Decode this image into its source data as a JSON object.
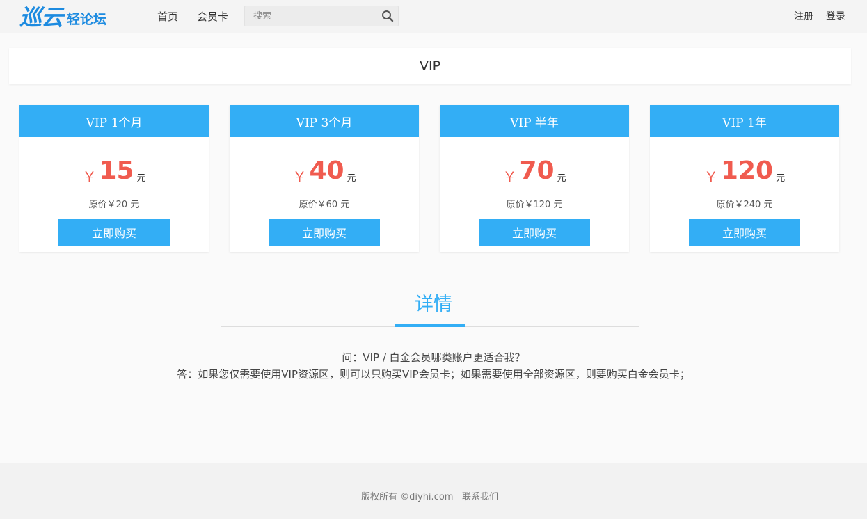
{
  "header": {
    "logo_main": "巡云",
    "logo_sub": "轻论坛",
    "nav": [
      {
        "label": "首页"
      },
      {
        "label": "会员卡"
      }
    ],
    "search": {
      "placeholder": "搜索",
      "value": ""
    },
    "auth": {
      "register": "注册",
      "login": "登录"
    }
  },
  "page": {
    "title": "VIP"
  },
  "plans": [
    {
      "name": "VIP 1个月",
      "currency": "￥",
      "price": "15",
      "unit": "元",
      "original": "原价￥20 元",
      "button": "立即购买"
    },
    {
      "name": "VIP 3个月",
      "currency": "￥",
      "price": "40",
      "unit": "元",
      "original": "原价￥60 元",
      "button": "立即购买"
    },
    {
      "name": "VIP 半年",
      "currency": "￥",
      "price": "70",
      "unit": "元",
      "original": "原价￥120 元",
      "button": "立即购买"
    },
    {
      "name": "VIP 1年",
      "currency": "￥",
      "price": "120",
      "unit": "元",
      "original": "原价￥240 元",
      "button": "立即购买"
    }
  ],
  "details": {
    "title": "详情",
    "question": "问：VIP / 白金会员哪类账户更适合我？",
    "answer": "答：如果您仅需要使用VIP资源区，则可以只购买VIP会员卡；如果需要使用全部资源区，则要购买白金会员卡；"
  },
  "footer": {
    "copyright": "版权所有 ©diyhi.com",
    "contact": "联系我们"
  },
  "colors": {
    "accent": "#33aef5",
    "price": "#f05b4f",
    "logo": "#1d8be0"
  },
  "icons": {
    "search": "search-icon"
  }
}
